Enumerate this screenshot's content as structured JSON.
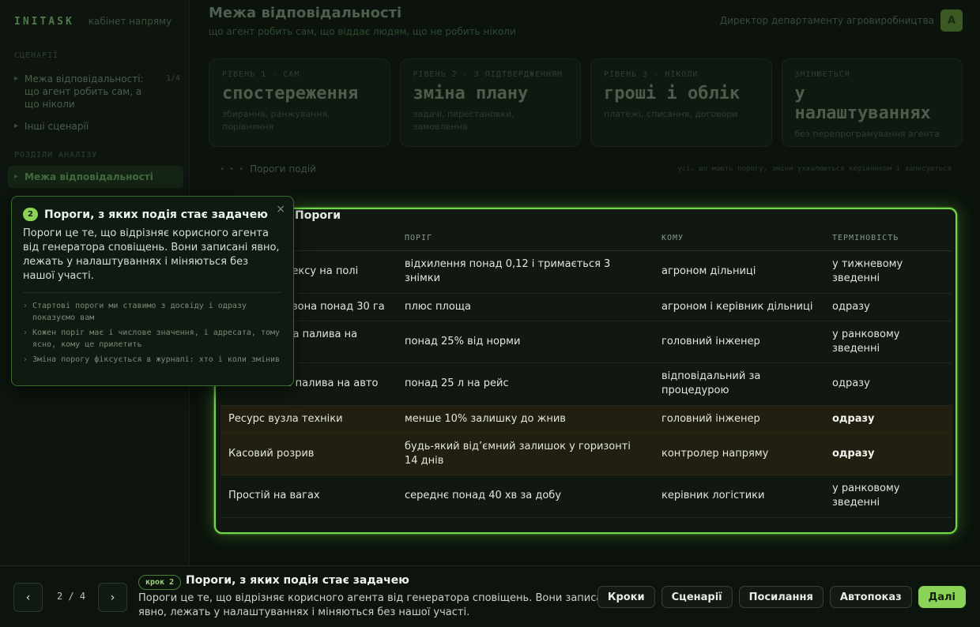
{
  "app": {
    "brand": "INITASK",
    "brand_sub": "кабінет напряму"
  },
  "sidebar": {
    "section1": "Сценарії",
    "items": [
      {
        "label": "Межа відповідальності: що агент робить сам, а що ніколи",
        "count": "1/4"
      },
      {
        "label": "Інші сценарії"
      }
    ],
    "section2": "Розділи аналізу",
    "active_item": "Межа відповідальності"
  },
  "header": {
    "title": "Межа відповідальності",
    "subtitle": "що агент робить сам, що віддає людям, що не робить ніколи",
    "user_role": "Директор департаменту агровиробництва",
    "avatar_letter": "А"
  },
  "cards": [
    {
      "kicker": "Рівень 1 · сам",
      "title": "спостереження",
      "desc": "збирання, ранжування, порівняння"
    },
    {
      "kicker": "Рівень 2 · з підтвердженням",
      "title": "зміна плану",
      "desc": "задачі, перестановки, замовлення"
    },
    {
      "kicker": "Рівень 3 · ніколи",
      "title": "гроші і облік",
      "desc": "платежі, списання, договори"
    },
    {
      "kicker": "Змінюється",
      "title": "у налаштуваннях",
      "desc": "без перепрограмування агента"
    }
  ],
  "crumbs": {
    "dots": "• • •",
    "label": "Пороги подій",
    "note": "усі, що мають порогу, зміни ухвалюються керівником і записуються"
  },
  "panel": {
    "title": "Пороги",
    "columns": [
      "Подія",
      "Поріг",
      "Кому",
      "Терміновість"
    ],
    "rows": [
      {
        "event": "Падіння індексу на полі",
        "threshold": "відхилення понад 0,12 і тримається 3 знімки",
        "to": "агроном дільниці",
        "urgency": "у тижневому зведенні",
        "highlight": false
      },
      {
        "event": "Проблемна зона понад 30 га",
        "threshold": "плюс площа",
        "to": "агроном і керівник дільниці",
        "urgency": "одразу",
        "highlight": false
      },
      {
        "event": "Перевитрата палива на техніці",
        "threshold": "понад 25% від норми",
        "to": "головний інженер",
        "urgency": "у ранковому зведенні",
        "highlight": false
      },
      {
        "event": "Розбіжність палива на авто",
        "threshold": "понад 25 л на рейс",
        "to": "відповідальний за процедурою",
        "urgency": "одразу",
        "highlight": false
      },
      {
        "event": "Ресурс вузла техніки",
        "threshold": "менше 10% залишку до жнив",
        "to": "головний інженер",
        "urgency": "одразу",
        "highlight": true
      },
      {
        "event": "Касовий розрив",
        "threshold": "будь-який від’ємний залишок у горизонті 14 днів",
        "to": "контролер напряму",
        "urgency": "одразу",
        "highlight": true
      },
      {
        "event": "Простій на вагах",
        "threshold": "середнє понад 40 хв за добу",
        "to": "керівник логістики",
        "urgency": "у ранковому зведенні",
        "highlight": false
      }
    ]
  },
  "tooltip": {
    "step": "2",
    "title": "Пороги, з яких подія стає задачею",
    "body": "Пороги це те, що відрізняє корисного агента від генератора сповіщень. Вони записані явно, лежать у налаштуваннях і міняються без нашої участі.",
    "close": "×",
    "notes": [
      "Стартові пороги ми ставимо з досвіду і одразу показуємо вам",
      "Кожен поріг має і числове значення, і адресата, тому ясно, кому це прилетить",
      "Зміна порогу фіксується в журналі: хто і коли змінив"
    ]
  },
  "bar": {
    "prev": "‹",
    "next": "›",
    "counter": "2 / 4",
    "step_pill": "крок 2",
    "title": "Пороги, з яких подія стає задачею",
    "body": "Пороги це те, що відрізняє корисного агента від генератора сповіщень. Вони записані явно, лежать у налаштуваннях і міняються без нашої участі.",
    "actions": [
      "Кроки",
      "Сценарії",
      "Посилання",
      "Автопоказ"
    ],
    "primary": "Далі"
  },
  "colors": {
    "accent": "#8ad357",
    "panel_border": "#72d846",
    "highlight_row": "#221f11",
    "background": "#0b130c"
  }
}
